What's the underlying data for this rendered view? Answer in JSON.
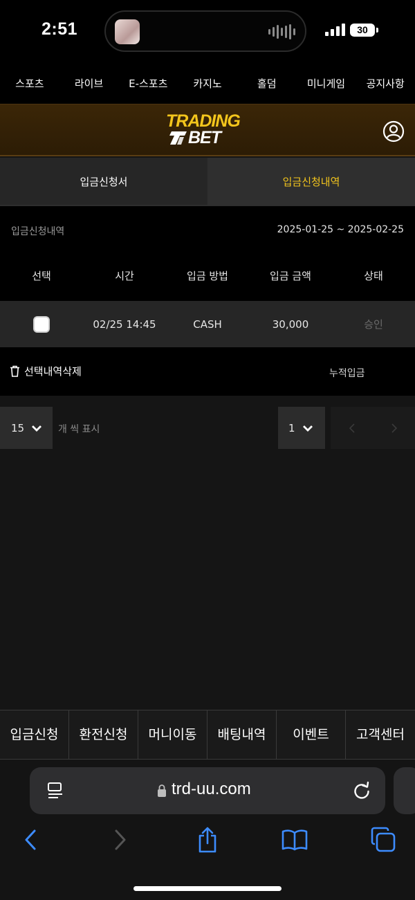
{
  "status_bar": {
    "time": "2:51",
    "battery": "30"
  },
  "top_nav": [
    "스포츠",
    "라이브",
    "E-스포츠",
    "카지노",
    "홀덤",
    "미니게임",
    "공지사항"
  ],
  "header": {
    "logo_line1": "TRADING",
    "logo_line2": "BET",
    "brand_color": "#f3c51c"
  },
  "tabs": {
    "deposit_form": "입금신청서",
    "deposit_history": "입금신청내역"
  },
  "list": {
    "title": "입금신청내역",
    "date_range": "2025-01-25 ~ 2025-02-25",
    "columns": [
      "선택",
      "시간",
      "입금 방법",
      "입금 금액",
      "상태"
    ],
    "rows": [
      {
        "time": "02/25 14:45",
        "method": "CASH",
        "amount": "30,000",
        "status": "승인"
      }
    ]
  },
  "actions": {
    "delete_selected": "선택내역삭제",
    "cumulative": "누적입금"
  },
  "pagination": {
    "page_size": "15",
    "per_page_label": "개 씩 표시",
    "page": "1"
  },
  "bottom_menu": [
    "입금신청",
    "환전신청",
    "머니이동",
    "배팅내역",
    "이벤트",
    "고객센터"
  ],
  "browser": {
    "url": "trd-uu.com"
  }
}
